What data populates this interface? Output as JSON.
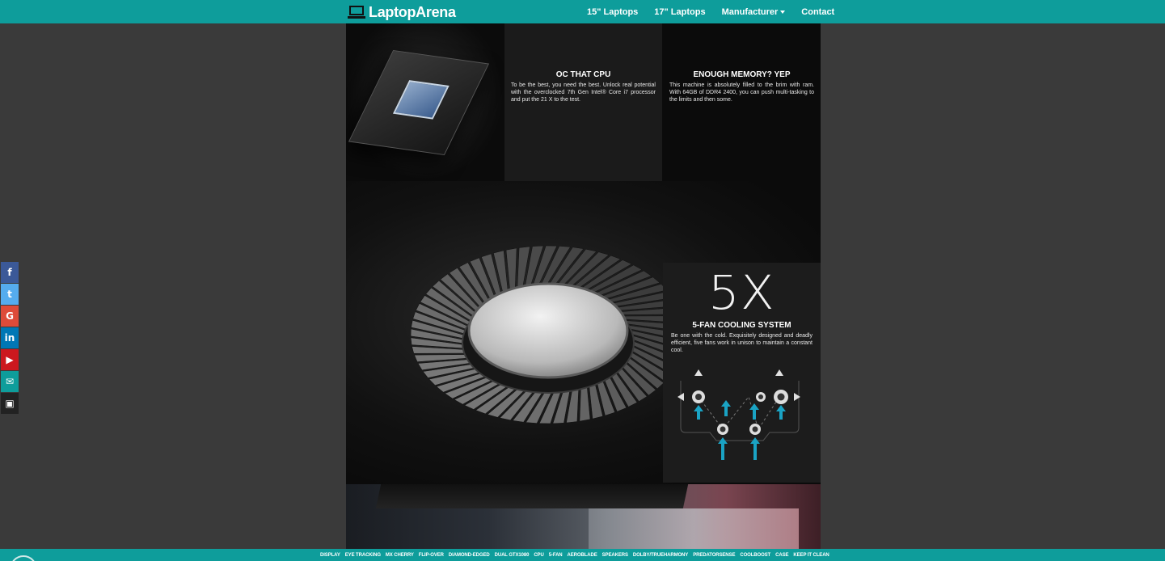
{
  "brand": {
    "name": "LaptopArena"
  },
  "nav": {
    "items": [
      {
        "label": "15\" Laptops"
      },
      {
        "label": "17\" Laptops"
      },
      {
        "label": "Manufacturer"
      },
      {
        "label": "Contact"
      }
    ]
  },
  "cpu": {
    "title": "OC THAT CPU",
    "text": "To be the best, you need the best. Unlock real potential with the overclocked 7th Gen Intel® Core i7 processor and put the 21 X to the test."
  },
  "memory": {
    "title": "ENOUGH MEMORY? YEP",
    "text": "This machine is absolutely filled to the brim with ram. With 64GB of DDR4 2400, you can push multi-tasking to the limits and then some."
  },
  "cooling": {
    "big": "5X",
    "title": "5-FAN COOLING SYSTEM",
    "text": "Be one with the cold. Exquisitely designed and deadly efficient, five fans work in unison to maintain a constant cool."
  },
  "social": [
    {
      "glyph": "f",
      "color": "#3b5998"
    },
    {
      "glyph": "t",
      "color": "#55acee"
    },
    {
      "glyph": "G",
      "color": "#dd4b39"
    },
    {
      "glyph": "in",
      "color": "#0077b5"
    },
    {
      "glyph": "▶",
      "color": "#cc181e"
    },
    {
      "glyph": "✉",
      "color": "#0e9d9b"
    },
    {
      "glyph": "▣",
      "color": "#222222"
    }
  ],
  "bottom_nav": [
    "DISPLAY",
    "EYE TRACKING",
    "MX CHERRY",
    "FLIP-OVER",
    "DIAMOND-EDGED",
    "DUAL GTX1080",
    "CPU",
    "5-FAN",
    "AEROBLADE",
    "SPEAKERS",
    "DOLBY/TRUEHARMONY",
    "PREDATORSENSE",
    "COOLBOOST",
    "CASE",
    "KEEP IT CLEAN"
  ],
  "colors": {
    "accent": "#0e9d9b",
    "background": "#3a3a3a",
    "arrow": "#1aa3c4"
  }
}
